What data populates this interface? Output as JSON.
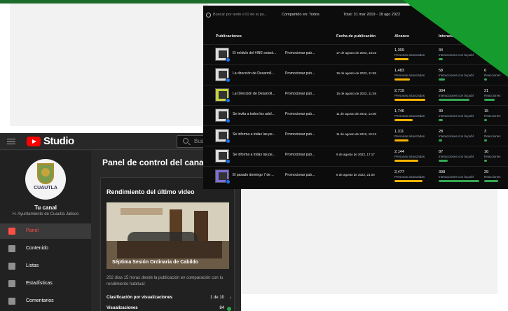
{
  "studio": {
    "app_name": "Studio",
    "search_placeholder": "Bus",
    "channel": {
      "avatar_text": "CUAUTLA",
      "label": "Tu canal",
      "name": "H. Ayuntamiento de Cuautla Jalisco"
    },
    "nav": [
      {
        "label": "Panel",
        "active": true
      },
      {
        "label": "Contenido",
        "active": false
      },
      {
        "label": "Listas",
        "active": false
      },
      {
        "label": "Estadísticas",
        "active": false
      },
      {
        "label": "Comentarios",
        "active": false
      }
    ],
    "page_title": "Panel de control del canal",
    "card": {
      "title": "Rendimiento del último video",
      "thumbnail_caption": "Séptima Sesión Ordinaria de Cabildo",
      "description": "202 días 15 horas desde la publicación en comparación con tu rendimiento habitual:",
      "ranking_label": "Clasificación por visualizaciones",
      "ranking_value": "1 de 10",
      "views_label": "Visualizaciones",
      "views_value": "84"
    }
  },
  "facebook": {
    "search_placeholder": "Buscar por texto o ID de la pu...",
    "shared_filter": "Compartido en: Todos",
    "total_range": "Total: 31 mar 2019 - 18 ago 2022",
    "columns": [
      "Publicaciones",
      "Fecha de publicación",
      "Alcance",
      "Interacción"
    ],
    "reach_sub": "Personas alcanzadas",
    "interaction_sub": "Interacciones con la publ",
    "reactions_sub": "Reacciones",
    "rows": [
      {
        "title": "El módulo del #INE estará...",
        "action": "Promocionar pub...",
        "date": "17 de agosto de 2022, 18:22",
        "reach": "1,309",
        "reach_frac": 0.45,
        "interactions": "34",
        "inter_frac": 0.1,
        "reactions": "7"
      },
      {
        "title": "La dirección de Desarroll...",
        "action": "Promocionar pub...",
        "date": "15 de agosto de 2022, 11:55",
        "reach": "1,483",
        "reach_frac": 0.5,
        "interactions": "58",
        "inter_frac": 0.15,
        "reactions": "6"
      },
      {
        "title": "La Dirección de Desarroll...",
        "action": "Promocionar pub...",
        "date": "15 de agosto de 2022, 11:26",
        "reach": "2,719",
        "reach_frac": 1.0,
        "interactions": "304",
        "inter_frac": 0.75,
        "reactions": "21"
      },
      {
        "title": "Se invita a todos los adol...",
        "action": "Promocionar pub...",
        "date": "11 de agosto de 2022, 14:00",
        "reach": "1,746",
        "reach_frac": 0.6,
        "interactions": "39",
        "inter_frac": 0.1,
        "reactions": "15"
      },
      {
        "title": "Se informa a todas las pe...",
        "action": "Promocionar pub...",
        "date": "11 de agosto de 2022, 10:13",
        "reach": "1,311",
        "reach_frac": 0.45,
        "interactions": "28",
        "inter_frac": 0.08,
        "reactions": "3"
      },
      {
        "title": "Se informa a todas las pe...",
        "action": "Promocionar pub...",
        "date": "9 de agosto de 2022, 17:17",
        "reach": "2,144",
        "reach_frac": 0.78,
        "interactions": "87",
        "inter_frac": 0.22,
        "reactions": "16"
      },
      {
        "title": "El pasado domingo 7 de ...",
        "action": "Promocionar pub...",
        "date": "8 de agosto de 2022, 21:00",
        "reach": "2,477",
        "reach_frac": 0.9,
        "interactions": "398",
        "inter_frac": 1.0,
        "reactions": "29"
      }
    ]
  },
  "colors": {
    "brand_green": "#169b2e",
    "yt_red": "#ff0000",
    "fb_blue": "#1877f2",
    "reach_bar": "#f4b400",
    "interaction_bar": "#34a853"
  }
}
